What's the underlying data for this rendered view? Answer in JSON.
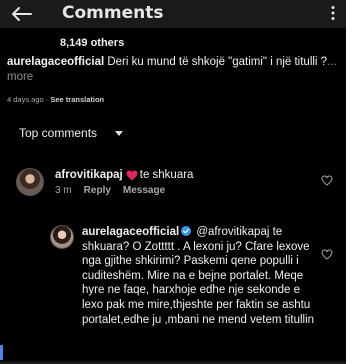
{
  "header": {
    "title": "Comments"
  },
  "post": {
    "likes_label": "8,149 others",
    "caption_user": "aurelagaceofficial",
    "caption_text": " Deri ku mund të shkojë \"gatimi\" i një titulli ?",
    "caption_more": "... more",
    "age": "4 days ago",
    "separator": " · ",
    "see_translation": "See translation"
  },
  "sort": {
    "label": "Top comments"
  },
  "comments": [
    {
      "user": "afrovitikapaj",
      "text": "te shkuara",
      "time": "3 m",
      "reply_label": "Reply",
      "message_label": "Message"
    },
    {
      "user": "aurelagaceofficial",
      "text": " @afrovitikapaj te shkuara? O Zottttt . A lexoni ju? Cfare lexove nga gjithe shkirimi? Paskemi qene populli i cuditeshëm. Mire na e bejne portalet.  Meqe hyre ne faqe, harxhoje edhe nje sekonde e lexo pak me mire,thjeshte per faktin se ashtu portalet,edhe ju ,mbani ne mend vetem titullin",
      "verified_color": "#3897f0"
    }
  ],
  "colors": {
    "heart_emoji": "#e0245e",
    "muted_text": "#a8a8a8"
  }
}
